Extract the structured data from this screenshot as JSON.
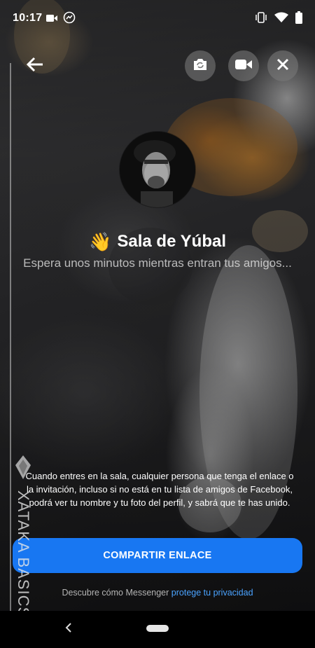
{
  "status_bar": {
    "time": "10:17",
    "left_icons": [
      "video-camera-icon",
      "messenger-icon"
    ],
    "right_icons": [
      "vibrate-icon",
      "wifi-icon",
      "battery-icon"
    ]
  },
  "top_controls": {
    "back": "back-arrow-icon",
    "flip_camera": "flip-camera-icon",
    "video": "video-camera-icon",
    "close": "close-icon"
  },
  "room": {
    "emoji": "👋",
    "title": "Sala de Yúbal",
    "subtitle": "Espera unos minutos mientras entran tus amigos..."
  },
  "notice": {
    "text": "Cuando entres en la sala, cualquier persona que tenga el enlace o la invitación, incluso si no está en tu lista de amigos de Facebook, podrá ver tu nombre y tu foto del perfil, y sabrá que te has unido."
  },
  "share_button": {
    "label": "COMPARTIR ENLACE"
  },
  "privacy": {
    "text": "Descubre cómo Messenger",
    "link": "protege tu privacidad"
  },
  "watermark": {
    "text": "XATAKA BASICS"
  },
  "colors": {
    "primary_blue": "#1877f2",
    "link_blue": "#4aa3ff"
  }
}
